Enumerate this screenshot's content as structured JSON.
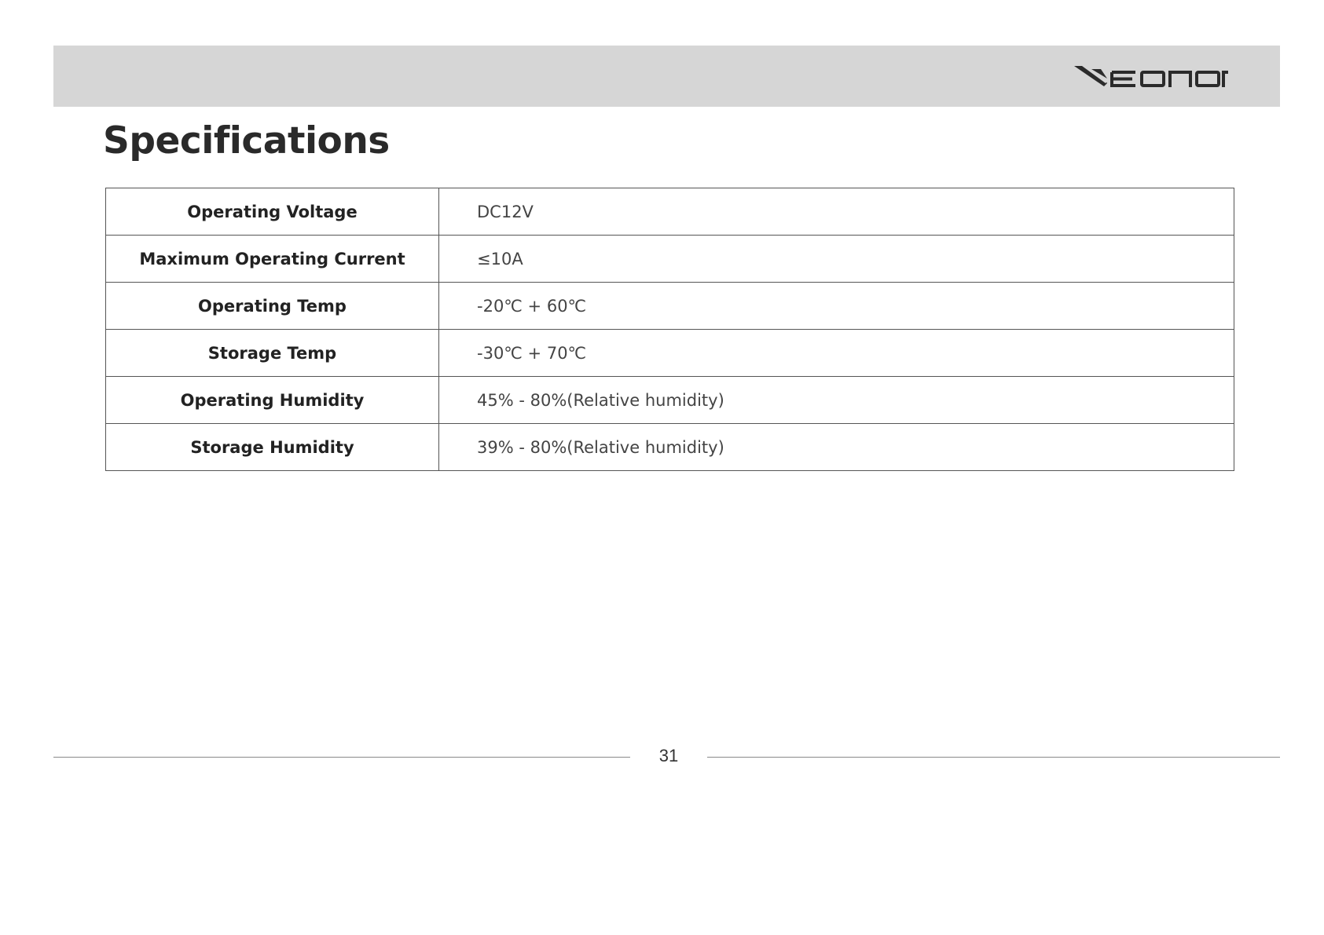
{
  "header": {
    "logo_text": "EONON",
    "background_color": "#d6d6d6"
  },
  "page_title": "Specifications",
  "specs": [
    {
      "label": "Operating Voltage",
      "value": "DC12V"
    },
    {
      "label": "Maximum Operating Current",
      "value": "≤10A"
    },
    {
      "label": "Operating Temp",
      "value": "-20℃ + 60℃"
    },
    {
      "label": "Storage Temp",
      "value": "-30℃ + 70℃"
    },
    {
      "label": "Operating Humidity",
      "value": "45% - 80%(Relative humidity)"
    },
    {
      "label": "Storage Humidity",
      "value": "39% - 80%(Relative humidity)"
    }
  ],
  "footer": {
    "page_number": "31"
  }
}
